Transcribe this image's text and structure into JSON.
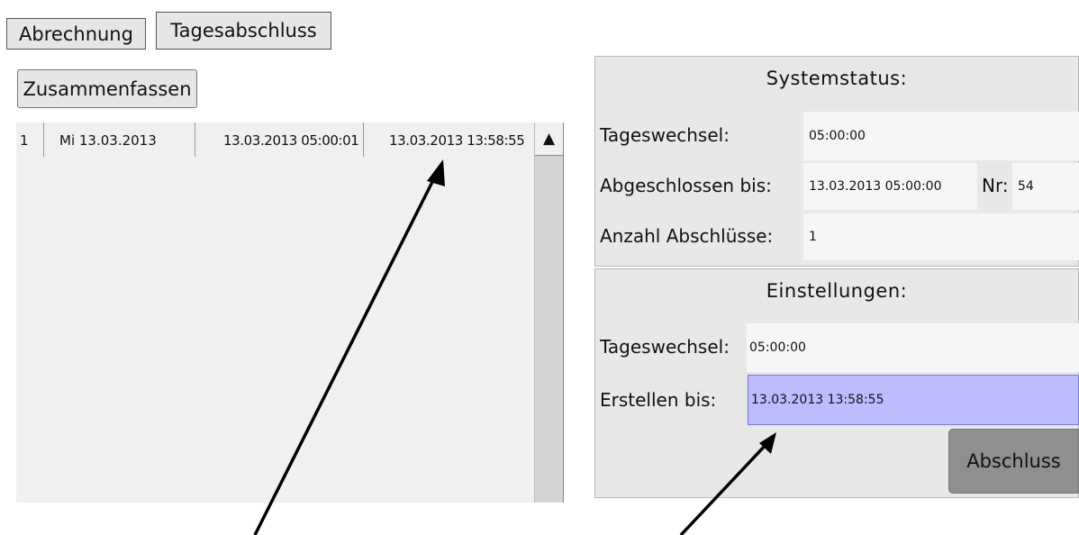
{
  "tabs": [
    {
      "label": "Abrechnung"
    },
    {
      "label": "Tagesabschluss"
    }
  ],
  "summarize_label": "Zusammenfassen",
  "list": {
    "rows": [
      {
        "nr": "1",
        "day": "Mi 13.03.2013",
        "from": "13.03.2013 05:00:01",
        "to": "13.03.2013 13:58:55"
      }
    ],
    "scroll_up_glyph": "▲"
  },
  "system_status": {
    "title": "Systemstatus:",
    "tageswechsel_label": "Tageswechsel:",
    "tageswechsel_value": "05:00:00",
    "abgeschlossen_label": "Abgeschlossen bis:",
    "abgeschlossen_value": "13.03.2013 05:00:00",
    "nr_label": "Nr:",
    "nr_value": "54",
    "anzahl_label": "Anzahl Abschlüsse:",
    "anzahl_value": "1"
  },
  "settings": {
    "title": "Einstellungen:",
    "tageswechsel_label": "Tageswechsel:",
    "tageswechsel_value": "05:00:00",
    "erstellen_label": "Erstellen bis:",
    "erstellen_value": "13.03.2013 13:58:55"
  },
  "abschluss_label": "Abschluss",
  "colors": {
    "selected_field": "#bcbcff",
    "button_dark": "#8f8f8f",
    "panel_bg": "#e8e8e8"
  }
}
